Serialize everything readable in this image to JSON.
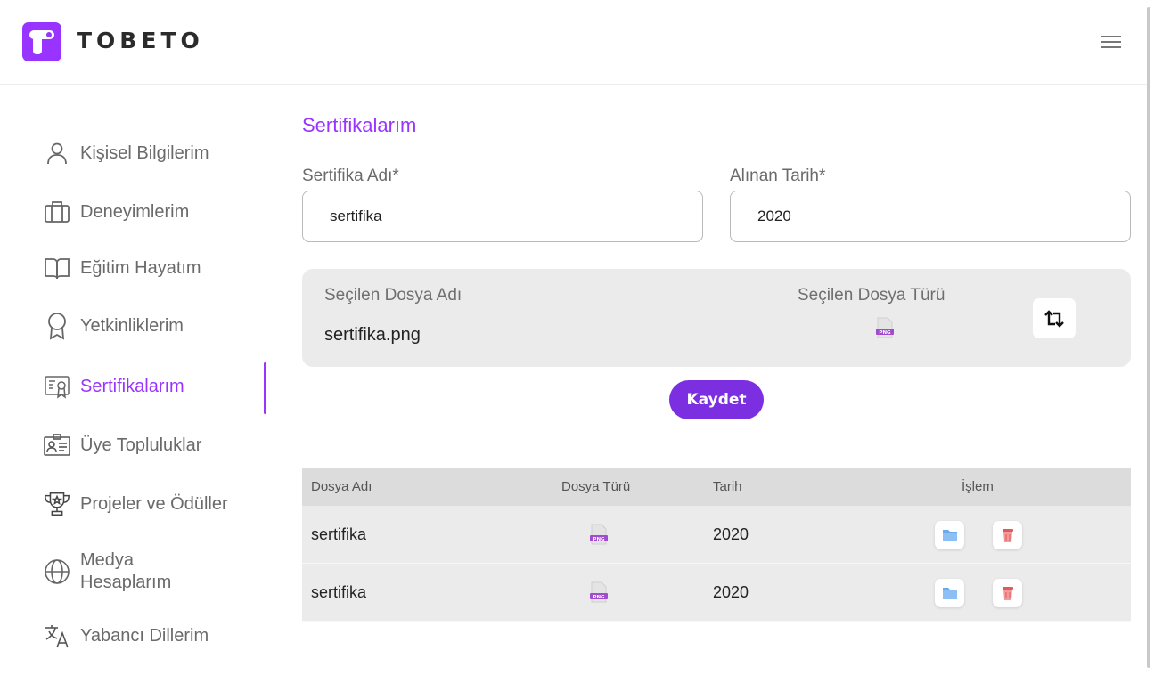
{
  "header": {
    "logo_text": "TOBETO",
    "menu_icon": "hamburger-menu-icon"
  },
  "sidebar": {
    "items": [
      {
        "label": "Kişisel Bilgilerim",
        "icon": "user-icon",
        "active": false
      },
      {
        "label": "Deneyimlerim",
        "icon": "briefcase-icon",
        "active": false
      },
      {
        "label": "Eğitim Hayatım",
        "icon": "book-icon",
        "active": false
      },
      {
        "label": "Yetkinliklerim",
        "icon": "award-icon",
        "active": false
      },
      {
        "label": "Sertifikalarım",
        "icon": "certificate-icon",
        "active": true
      },
      {
        "label": "Üye Topluluklar",
        "icon": "id-card-icon",
        "active": false
      },
      {
        "label": "Projeler ve Ödüller",
        "icon": "trophy-icon",
        "active": false
      },
      {
        "label": "Medya Hesaplarım",
        "icon": "globe-icon",
        "active": false
      },
      {
        "label": "Yabancı Dillerim",
        "icon": "translate-icon",
        "active": false
      }
    ]
  },
  "main": {
    "title": "Sertifikalarım",
    "form": {
      "name_label": "Sertifika Adı*",
      "name_value": "sertifika",
      "date_label": "Alınan Tarih*",
      "date_value": "2020"
    },
    "file_panel": {
      "selected_name_label": "Seçilen Dosya Adı",
      "selected_name_value": "sertifika.png",
      "selected_type_label": "Seçilen Dosya Türü",
      "selected_type_icon": "png-file-icon",
      "png_badge": "PNG",
      "swap_icon": "swap-arrows-icon"
    },
    "save_label": "Kaydet",
    "table": {
      "headers": [
        "Dosya Adı",
        "Dosya Türü",
        "Tarih",
        "İşlem"
      ],
      "rows": [
        {
          "name": "sertifika",
          "type": "PNG",
          "date": "2020"
        },
        {
          "name": "sertifika",
          "type": "PNG",
          "date": "2020"
        }
      ],
      "actions": {
        "view_icon": "folder-icon",
        "delete_icon": "trash-icon"
      }
    }
  },
  "colors": {
    "accent": "#9933ff",
    "button": "#7b2fe0",
    "panel": "#ebebeb",
    "table_header": "#dcdcdc"
  }
}
